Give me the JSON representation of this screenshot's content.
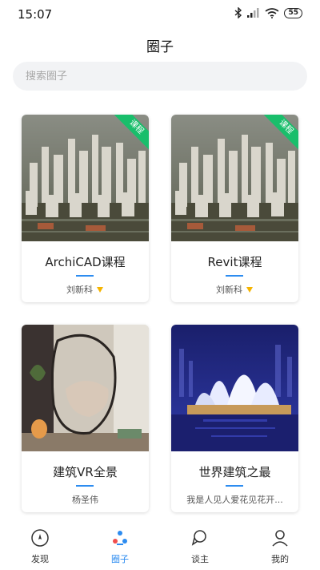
{
  "status": {
    "time": "15:07",
    "battery": "55"
  },
  "header": {
    "title": "圈子"
  },
  "search": {
    "placeholder": "搜索圈子"
  },
  "cards": [
    {
      "title": "ArchiCAD课程",
      "author": "刘新科",
      "badge": "课程",
      "verified": true
    },
    {
      "title": "Revit课程",
      "author": "刘新科",
      "badge": "课程",
      "verified": true
    },
    {
      "title": "建筑VR全景",
      "author": "杨圣伟"
    },
    {
      "title": "世界建筑之最",
      "author": "我是人见人爱花见花开..."
    }
  ],
  "tabs": [
    {
      "label": "发现",
      "icon": "discover-icon",
      "active": false
    },
    {
      "label": "圈子",
      "icon": "circle-icon",
      "active": true
    },
    {
      "label": "谈主",
      "icon": "chat-icon",
      "active": false
    },
    {
      "label": "我的",
      "icon": "profile-icon",
      "active": false
    }
  ],
  "colors": {
    "accent": "#2d8cf0",
    "badge": "#19be6b",
    "verified": "#f5b400"
  }
}
